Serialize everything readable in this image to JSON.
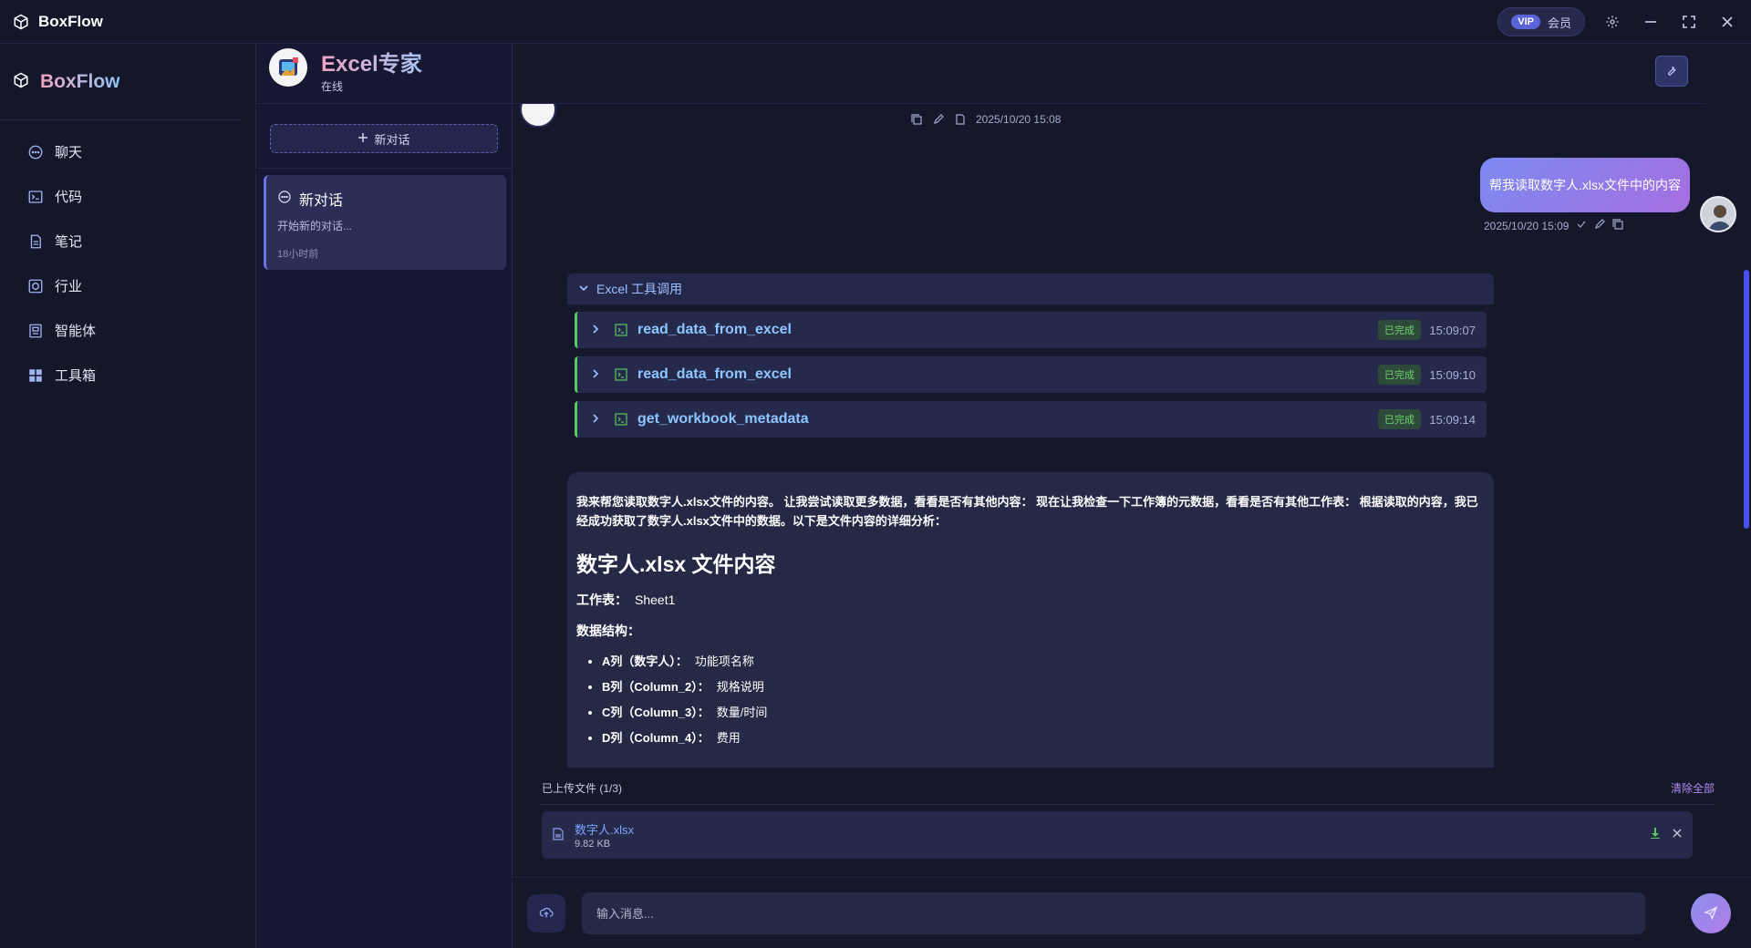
{
  "app": {
    "title": "BoxFlow"
  },
  "titlebar": {
    "vip_tag": "VIP",
    "vip_label": "会员"
  },
  "sidebar": {
    "brand": "BoxFlow",
    "items": [
      {
        "label": "聊天",
        "icon": "chat-bubble-icon"
      },
      {
        "label": "代码",
        "icon": "terminal-icon"
      },
      {
        "label": "笔记",
        "icon": "document-icon"
      },
      {
        "label": "行业",
        "icon": "industry-icon"
      },
      {
        "label": "智能体",
        "icon": "robot-icon"
      },
      {
        "label": "工具箱",
        "icon": "grid-icon"
      }
    ]
  },
  "conversations": {
    "new_label": "新对话",
    "items": [
      {
        "title": "新对话",
        "preview": "开始新的对话...",
        "time": "18小时前"
      }
    ]
  },
  "agent": {
    "name": "Excel专家",
    "status": "在线"
  },
  "messages": {
    "first_timestamp": "2025/10/20 15:08",
    "user": {
      "text": "帮我读取数字人.xlsx文件中的内容",
      "timestamp": "2025/10/20 15:09"
    },
    "tools": {
      "header": "Excel 工具调用",
      "calls": [
        {
          "name": "read_data_from_excel",
          "status": "已完成",
          "time": "15:09:07"
        },
        {
          "name": "read_data_from_excel",
          "status": "已完成",
          "time": "15:09:10"
        },
        {
          "name": "get_workbook_metadata",
          "status": "已完成",
          "time": "15:09:14"
        }
      ]
    },
    "assistant": {
      "intro": "我来帮您读取数字人.xlsx文件的内容。 让我尝试读取更多数据，看看是否有其他内容： 现在让我检查一下工作簿的元数据，看看是否有其他工作表： 根据读取的内容，我已经成功获取了数字人.xlsx文件中的数据。以下是文件内容的详细分析：",
      "heading": "数字人.xlsx 文件内容",
      "sheet_label": "工作表：",
      "sheet_value": "Sheet1",
      "structure_label": "数据结构：",
      "columns": [
        {
          "key": "A列（数字人）：",
          "value": "功能项名称"
        },
        {
          "key": "B列（Column_2）：",
          "value": "规格说明"
        },
        {
          "key": "C列（Column_3）：",
          "value": "数量/时间"
        },
        {
          "key": "D列（Column_4）：",
          "value": "费用"
        }
      ]
    }
  },
  "uploads": {
    "header": "已上传文件 (1/3)",
    "clear_all": "清除全部",
    "file": {
      "name": "数字人.xlsx",
      "size": "9.82 KB"
    }
  },
  "input": {
    "placeholder": "输入消息..."
  }
}
